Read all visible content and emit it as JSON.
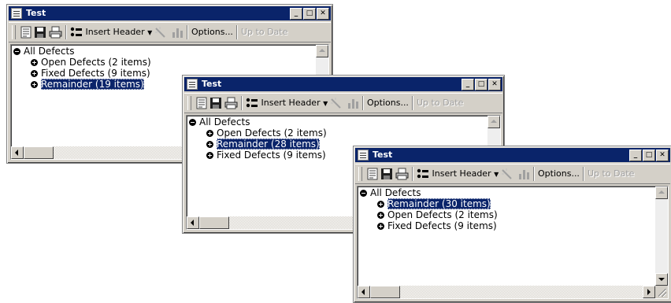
{
  "windows": [
    {
      "title": "Test",
      "toolbar": {
        "insert_header": "Insert Header",
        "options": "Options...",
        "up_to_date": "Up to Date"
      },
      "tree": {
        "root": "All Defects",
        "items": [
          {
            "label": "Open Defects (2 items)",
            "selected": false
          },
          {
            "label": "Fixed Defects (9 items)",
            "selected": false
          },
          {
            "label": "Remainder (19 items)",
            "selected": true
          }
        ]
      }
    },
    {
      "title": "Test",
      "toolbar": {
        "insert_header": "Insert Header",
        "options": "Options...",
        "up_to_date": "Up to Date"
      },
      "tree": {
        "root": "All Defects",
        "items": [
          {
            "label": "Open Defects (2 items)",
            "selected": false
          },
          {
            "label": "Remainder (28 items)",
            "selected": true
          },
          {
            "label": "Fixed Defects (9 items)",
            "selected": false
          }
        ]
      }
    },
    {
      "title": "Test",
      "toolbar": {
        "insert_header": "Insert Header",
        "options": "Options...",
        "up_to_date": "Up to Date"
      },
      "tree": {
        "root": "All Defects",
        "items": [
          {
            "label": "Remainder (30 items)",
            "selected": true
          },
          {
            "label": "Open Defects (2 items)",
            "selected": false
          },
          {
            "label": "Fixed Defects (9 items)",
            "selected": false
          }
        ]
      }
    }
  ],
  "title_buttons": {
    "minimize": "_",
    "maximize": "□",
    "close": "✕"
  },
  "colors": {
    "titlebar": "#0a246a",
    "face": "#d4d0c8",
    "selection": "#0a246a",
    "disabled_text": "#a0a0a0"
  }
}
